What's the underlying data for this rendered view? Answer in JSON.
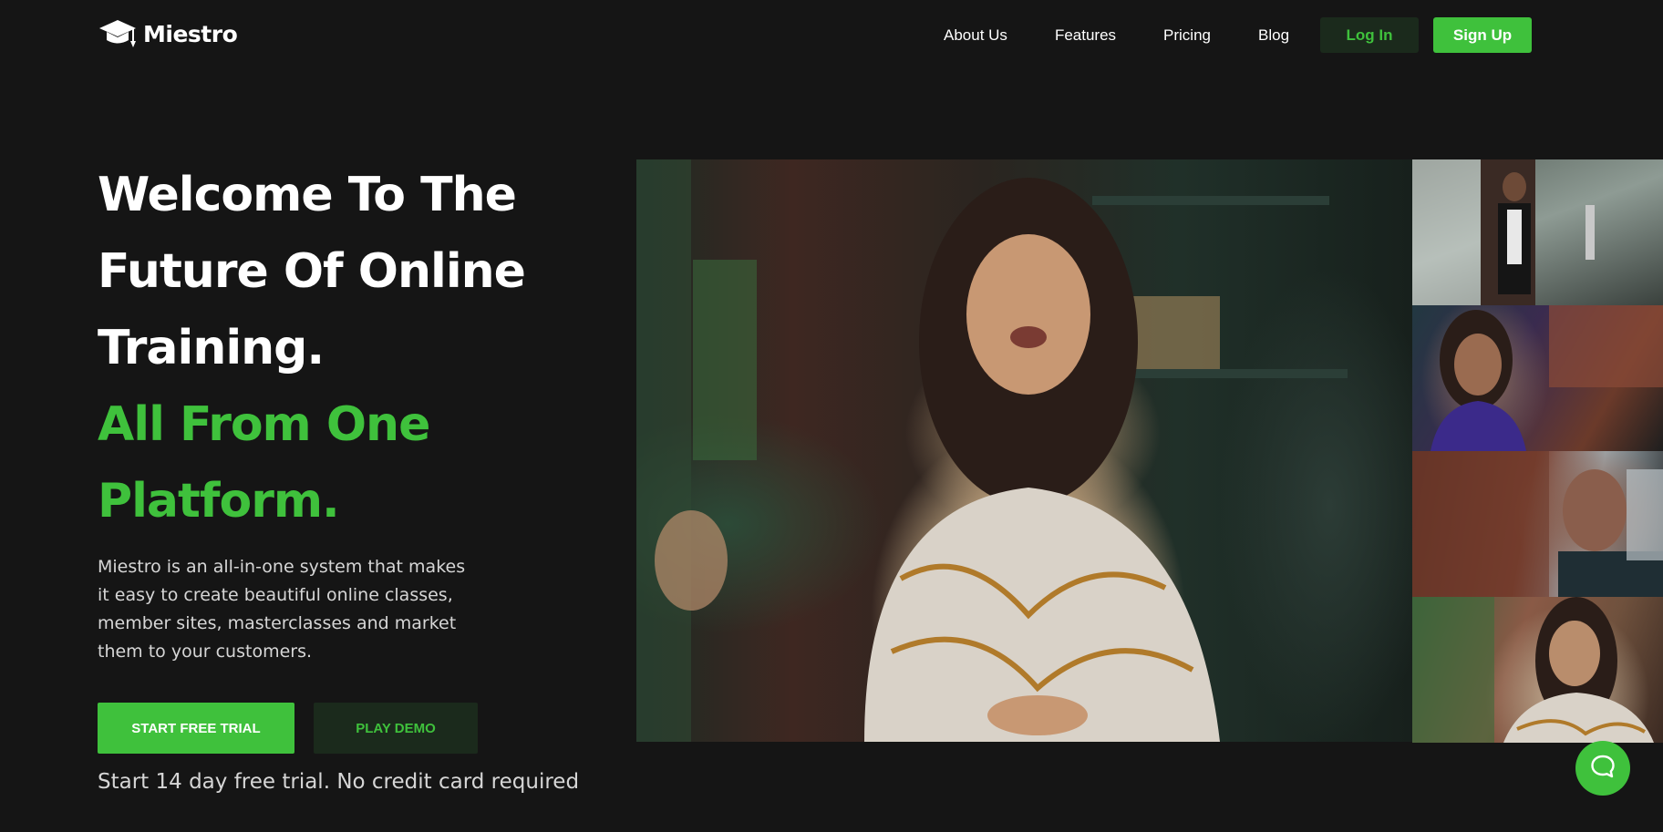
{
  "brand": {
    "name": "Miestro",
    "logo_icon": "graduation-cap-icon"
  },
  "nav": {
    "links": [
      {
        "label": "About Us"
      },
      {
        "label": "Features"
      },
      {
        "label": "Pricing"
      },
      {
        "label": "Blog"
      }
    ],
    "login_label": "Log In",
    "signup_label": "Sign Up"
  },
  "hero": {
    "title_lines": [
      "Welcome To The",
      "Future Of Online",
      "Training."
    ],
    "highlight_lines": [
      "All From One",
      "Platform."
    ],
    "description": "Miestro is an all-in-one system that makes it easy to create beautiful online classes, member sites, masterclasses and market them to your customers.",
    "primary_cta": "START FREE TRIAL",
    "secondary_cta": "PLAY DEMO",
    "trial_note": "Start 14 day free trial. No credit card required"
  },
  "media": {
    "main_video": "instructor-video",
    "thumbnails": [
      "thumbnail-1",
      "thumbnail-2",
      "thumbnail-3",
      "thumbnail-4"
    ]
  },
  "chat": {
    "icon": "chat-bubble-icon"
  },
  "colors": {
    "background": "#151515",
    "accent": "#3fc13c",
    "accent_dark": "#1b2a1c",
    "text": "#ffffff",
    "muted_text": "#d6d6d6"
  }
}
